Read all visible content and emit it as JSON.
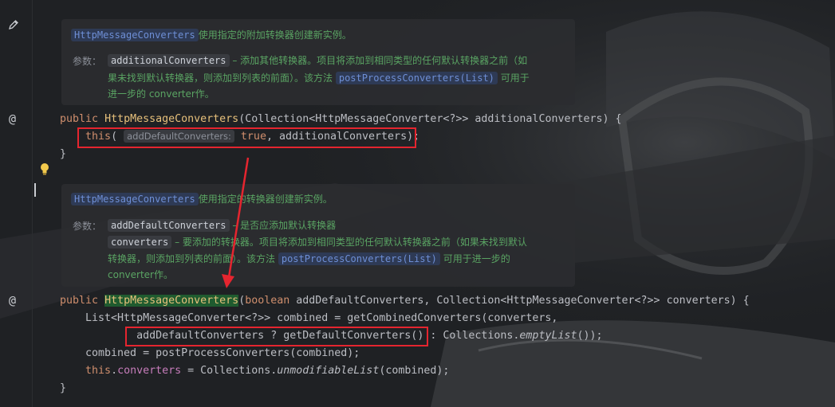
{
  "doc1": {
    "class_chip": "HttpMessageConverters",
    "summary": "使用指定的附加转换器创建新实例。",
    "params_label": "参数：",
    "param_chip": "additionalConverters",
    "desc_line1": " – 添加其他转换器。项目将添加到相同类型的任何默认转换器之前（如",
    "desc_line2a": "果未找到默认转换器，则添加到列表的前面）。该方法",
    "method_chip": "postProcessConverters(List)",
    "desc_line2b": "可用于",
    "desc_line3": "进一步的 converter作。"
  },
  "code1": {
    "line1": {
      "kw": "public",
      "fn": "HttpMessageConverters",
      "rest": "(Collection<HttpMessageConverter<?>> additionalConverters) {"
    },
    "line2": {
      "kw": "this",
      "open": "(",
      "hint": "addDefaultConverters:",
      "val": "true",
      "rest": ", additionalConverters);"
    },
    "line3": "}"
  },
  "doc2": {
    "class_chip": "HttpMessageConverters",
    "summary": "使用指定的转换器创建新实例。",
    "params_label": "参数：",
    "param1_chip": "addDefaultConverters",
    "param1_desc": " – 是否应添加默认转换器",
    "param2_chip": "converters",
    "param2_desc": " – 要添加的转换器。项目将添加到相同类型的任何默认转换器之前（如果未找到默认",
    "line3a": "转换器，则添加到列表的前面）。该方法",
    "method_chip": "postProcessConverters(List)",
    "line3b": "可用于进一步的",
    "line4": "converter作。"
  },
  "code2": {
    "line1": {
      "kw1": "public",
      "fn": "HttpMessageConverters",
      "open": "(",
      "kw2": "boolean",
      "rest": " addDefaultConverters, Collection<HttpMessageConverter<?>> converters) {"
    },
    "line2": "    List<HttpMessageConverter<?>> combined = getCombinedConverters(converters,",
    "line3": {
      "indent": "            ",
      "boxed": "addDefaultConverters ? getDefaultConverters()",
      "mid": " : Collections.",
      "ital": "emptyList",
      "end": "());"
    },
    "line4": "    combined = postProcessConverters(combined);",
    "line5": {
      "indent": "    ",
      "kw": "this",
      "dot": ".",
      "field": "converters",
      "mid": " = Collections.",
      "ital": "unmodifiableList",
      "end": "(combined);"
    },
    "line6": "}"
  },
  "gutter": {
    "edit_icon": "pencil-icon",
    "override_icon_1": "@",
    "bulb_icon": "lightbulb-icon",
    "override_icon_2": "@"
  },
  "colors": {
    "annotation_red": "#e5252f",
    "keyword": "#cf8e6d",
    "method": "#e6c07b",
    "doc_text": "#5aa463"
  }
}
